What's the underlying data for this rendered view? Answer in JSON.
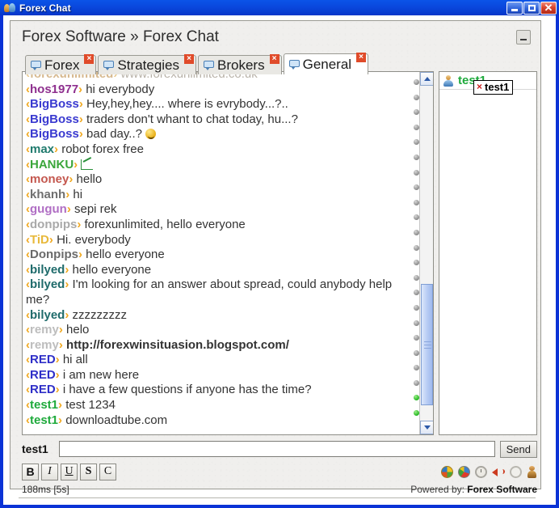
{
  "window": {
    "title": "Forex Chat",
    "icon": "users-icon",
    "controls": {
      "minimize": "minimize-icon",
      "maximize": "maximize-icon",
      "close": "close-icon"
    }
  },
  "header": {
    "breadcrumb": "Forex Software » Forex Chat",
    "minimize_label": "minimize-panel"
  },
  "tabs": [
    {
      "label": "Forex",
      "active": false,
      "icon": "chat-bubble-icon",
      "close": "×"
    },
    {
      "label": "Strategies",
      "active": false,
      "icon": "chat-bubble-icon",
      "close": "×"
    },
    {
      "label": "Brokers",
      "active": false,
      "icon": "chat-bubble-icon",
      "close": "×"
    },
    {
      "label": "General",
      "active": true,
      "icon": "chat-bubble-icon",
      "close": "×"
    }
  ],
  "chat": {
    "messages": [
      {
        "nick": "forexunlimited",
        "nick_color": "#d7b98f",
        "text": "www.forexunlimited.co.uk",
        "clipped": true,
        "status": "offline"
      },
      {
        "nick": "hos1977",
        "nick_color": "#8e2f8e",
        "text": "hi everybody",
        "status": "offline"
      },
      {
        "nick": "BigBoss",
        "nick_color": "#3a3ad0",
        "text": "Hey,hey,hey.... where is evrybody...?..",
        "status": "offline"
      },
      {
        "nick": "BigBoss",
        "nick_color": "#3a3ad0",
        "text": "traders don't whant to chat today, hu...?",
        "status": "offline"
      },
      {
        "nick": "BigBoss",
        "nick_color": "#3a3ad0",
        "text": "bad day..?",
        "emoji": "smiley-laughing-icon",
        "status": "offline"
      },
      {
        "nick": "max",
        "nick_color": "#1f7a6d",
        "text": "robot forex free",
        "status": "offline"
      },
      {
        "nick": "HANKU",
        "nick_color": "#3aa63a",
        "text": "",
        "emoji": "chart-icon",
        "status": "offline"
      },
      {
        "nick": "money",
        "nick_color": "#c4584f",
        "text": "hello",
        "status": "offline"
      },
      {
        "nick": "khanh",
        "nick_color": "#6f6f6f",
        "text": "hi",
        "status": "offline"
      },
      {
        "nick": "gugun",
        "nick_color": "#b06ec4",
        "text": "sepi rek",
        "status": "offline"
      },
      {
        "nick": "donpips",
        "nick_color": "#a9a9a9",
        "text": "forexunlimited, hello everyone",
        "status": "offline"
      },
      {
        "nick": "TiD",
        "nick_color": "#e8b93c",
        "text": "Hi. everybody",
        "status": "offline"
      },
      {
        "nick": "Donpips",
        "nick_color": "#6a6a6a",
        "text": "hello everyone",
        "status": "offline"
      },
      {
        "nick": "bilyed",
        "nick_color": "#1f6b6b",
        "text": "hello everyone",
        "status": "offline"
      },
      {
        "nick": "bilyed",
        "nick_color": "#1f6b6b",
        "text": "I'm looking for an answer about spread, could anybody help me?",
        "status": "offline"
      },
      {
        "nick": "bilyed",
        "nick_color": "#1f6b6b",
        "text": "zzzzzzzzz",
        "status": "offline"
      },
      {
        "nick": "remy",
        "nick_color": "#bdbdbd",
        "text": "helo",
        "status": "offline"
      },
      {
        "nick": "remy",
        "nick_color": "#bdbdbd",
        "text": "http://forexwinsituasion.blogspot.com/",
        "bold": true,
        "status": "offline"
      },
      {
        "nick": "RED",
        "nick_color": "#2f2fc8",
        "text": "hi all",
        "status": "offline"
      },
      {
        "nick": "RED",
        "nick_color": "#2f2fc8",
        "text": "i am new here",
        "status": "offline"
      },
      {
        "nick": "RED",
        "nick_color": "#2f2fc8",
        "text": "i have a few questions if anyone has the time?",
        "status": "offline"
      },
      {
        "nick": "test1",
        "nick_color": "#1faa3c",
        "text": "test 1234",
        "status": "online"
      },
      {
        "nick": "test1",
        "nick_color": "#1faa3c",
        "text": "downloadtube.com",
        "status": "online"
      }
    ],
    "scrollbar": {
      "up": "scroll-up-icon",
      "down": "scroll-down-icon"
    }
  },
  "userlist": {
    "users": [
      {
        "name": "test1",
        "avatar": "user-avatar-icon",
        "color": "#1faa3c"
      }
    ],
    "tooltip": {
      "text": "test1",
      "icon": "×"
    }
  },
  "input": {
    "nick": "test1",
    "value": "",
    "placeholder": "",
    "send_label": "Send"
  },
  "format_toolbar": {
    "buttons": [
      {
        "label": "B",
        "name": "bold-button"
      },
      {
        "label": "I",
        "name": "italic-button"
      },
      {
        "label": "U",
        "name": "underline-button"
      },
      {
        "label": "S",
        "name": "strike-button"
      },
      {
        "label": "C",
        "name": "color-button"
      }
    ],
    "icons": [
      "globe-icon",
      "colorball-icon",
      "clock-icon",
      "speaker-icon",
      "refresh-icon",
      "person-icon"
    ]
  },
  "status": {
    "latency": "188ms [5s]",
    "powered_prefix": "Powered by:",
    "powered_brand": "Forex Software"
  },
  "colors": {
    "title_blue": "#0b44d6",
    "bracket_orange": "#f0a81e",
    "panel_bg": "#f0efed",
    "online_green": "#23b520"
  }
}
